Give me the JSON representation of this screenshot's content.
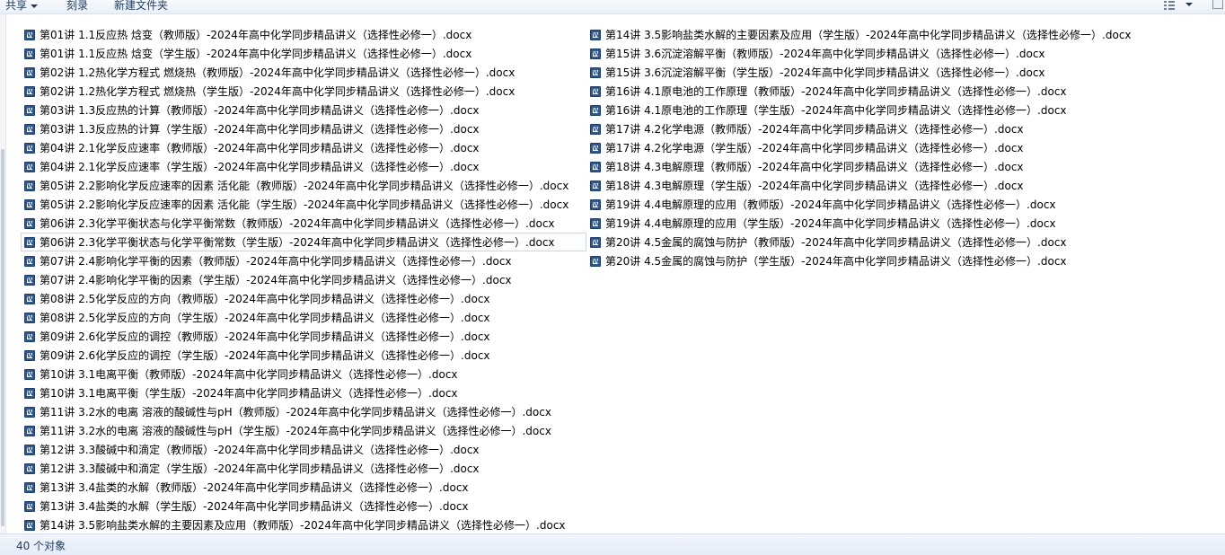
{
  "toolbar": {
    "share_label": "共享",
    "burn_label": "刻录",
    "new_folder_label": "新建文件夹",
    "view_icon": "view-toggle-icon",
    "help_icon": "preview-pane-icon"
  },
  "files_left": [
    {
      "name": "第01讲 1.1反应热  焓变（教师版）-2024年高中化学同步精品讲义（选择性必修一）.docx"
    },
    {
      "name": "第01讲 1.1反应热  焓变（学生版）-2024年高中化学同步精品讲义（选择性必修一）.docx"
    },
    {
      "name": "第02讲 1.2热化学方程式  燃烧热（教师版）-2024年高中化学同步精品讲义（选择性必修一）.docx"
    },
    {
      "name": "第02讲 1.2热化学方程式  燃烧热（学生版）-2024年高中化学同步精品讲义（选择性必修一）.docx"
    },
    {
      "name": "第03讲 1.3反应热的计算（教师版）-2024年高中化学同步精品讲义（选择性必修一）.docx"
    },
    {
      "name": "第03讲 1.3反应热的计算（学生版）-2024年高中化学同步精品讲义（选择性必修一）.docx"
    },
    {
      "name": "第04讲 2.1化学反应速率（教师版）-2024年高中化学同步精品讲义（选择性必修一）.docx"
    },
    {
      "name": "第04讲 2.1化学反应速率（学生版）-2024年高中化学同步精品讲义（选择性必修一）.docx"
    },
    {
      "name": "第05讲 2.2影响化学反应速率的因素  活化能（教师版）-2024年高中化学同步精品讲义（选择性必修一）.docx"
    },
    {
      "name": "第05讲 2.2影响化学反应速率的因素  活化能（学生版）-2024年高中化学同步精品讲义（选择性必修一）.docx"
    },
    {
      "name": "第06讲 2.3化学平衡状态与化学平衡常数（教师版）-2024年高中化学同步精品讲义（选择性必修一）.docx"
    },
    {
      "name": "第06讲 2.3化学平衡状态与化学平衡常数（学生版）-2024年高中化学同步精品讲义（选择性必修一）.docx"
    },
    {
      "name": "第07讲 2.4影响化学平衡的因素（教师版）-2024年高中化学同步精品讲义（选择性必修一）.docx"
    },
    {
      "name": "第07讲 2.4影响化学平衡的因素（学生版）-2024年高中化学同步精品讲义（选择性必修一）.docx"
    },
    {
      "name": "第08讲 2.5化学反应的方向（教师版）-2024年高中化学同步精品讲义（选择性必修一）.docx"
    },
    {
      "name": "第08讲 2.5化学反应的方向（学生版）-2024年高中化学同步精品讲义（选择性必修一）.docx"
    },
    {
      "name": "第09讲 2.6化学反应的调控（教师版）-2024年高中化学同步精品讲义（选择性必修一）.docx"
    },
    {
      "name": "第09讲 2.6化学反应的调控（学生版）-2024年高中化学同步精品讲义（选择性必修一）.docx"
    },
    {
      "name": "第10讲 3.1电离平衡（教师版）-2024年高中化学同步精品讲义（选择性必修一）.docx"
    },
    {
      "name": "第10讲 3.1电离平衡（学生版）-2024年高中化学同步精品讲义（选择性必修一）.docx"
    },
    {
      "name": "第11讲 3.2水的电离  溶液的酸碱性与pH（教师版）-2024年高中化学同步精品讲义（选择性必修一）.docx"
    },
    {
      "name": "第11讲 3.2水的电离  溶液的酸碱性与pH（学生版）-2024年高中化学同步精品讲义（选择性必修一）.docx"
    },
    {
      "name": "第12讲 3.3酸碱中和滴定（教师版）-2024年高中化学同步精品讲义（选择性必修一）.docx"
    },
    {
      "name": "第12讲 3.3酸碱中和滴定（学生版）-2024年高中化学同步精品讲义（选择性必修一）.docx"
    },
    {
      "name": "第13讲 3.4盐类的水解（教师版）-2024年高中化学同步精品讲义（选择性必修一）.docx"
    },
    {
      "name": "第13讲 3.4盐类的水解（学生版）-2024年高中化学同步精品讲义（选择性必修一）.docx"
    },
    {
      "name": "第14讲 3.5影响盐类水解的主要因素及应用（教师版）-2024年高中化学同步精品讲义（选择性必修一）.docx"
    }
  ],
  "files_right": [
    {
      "name": "第14讲 3.5影响盐类水解的主要因素及应用（学生版）-2024年高中化学同步精品讲义（选择性必修一）.docx"
    },
    {
      "name": "第15讲 3.6沉淀溶解平衡（教师版）-2024年高中化学同步精品讲义（选择性必修一）.docx"
    },
    {
      "name": "第15讲 3.6沉淀溶解平衡（学生版）-2024年高中化学同步精品讲义（选择性必修一）.docx"
    },
    {
      "name": "第16讲 4.1原电池的工作原理（教师版）-2024年高中化学同步精品讲义（选择性必修一）.docx"
    },
    {
      "name": "第16讲 4.1原电池的工作原理（学生版）-2024年高中化学同步精品讲义（选择性必修一）.docx"
    },
    {
      "name": "第17讲 4.2化学电源（教师版）-2024年高中化学同步精品讲义（选择性必修一）.docx"
    },
    {
      "name": "第17讲 4.2化学电源（学生版）-2024年高中化学同步精品讲义（选择性必修一）.docx"
    },
    {
      "name": "第18讲 4.3电解原理（教师版）-2024年高中化学同步精品讲义（选择性必修一）.docx"
    },
    {
      "name": "第18讲 4.3电解原理（学生版）-2024年高中化学同步精品讲义（选择性必修一）.docx"
    },
    {
      "name": "第19讲 4.4电解原理的应用（教师版）-2024年高中化学同步精品讲义（选择性必修一）.docx"
    },
    {
      "name": "第19讲 4.4电解原理的应用（学生版）-2024年高中化学同步精品讲义（选择性必修一）.docx"
    },
    {
      "name": "第20讲 4.5金属的腐蚀与防护（教师版）-2024年高中化学同步精品讲义（选择性必修一）.docx"
    },
    {
      "name": "第20讲 4.5金属的腐蚀与防护（学生版）-2024年高中化学同步精品讲义（选择性必修一）.docx"
    }
  ],
  "selected_item": "第06讲 2.3化学平衡状态与化学平衡常数（学生版）-2024年高中化学同步精品讲义（选择性必修一）.docx",
  "file_icon": "word-document-icon",
  "status": {
    "count_text": "40 个对象"
  },
  "colors": {
    "toolbar_text": "#1e395b",
    "word_icon": "#2b5797",
    "selection_border": "#c9d7e8"
  }
}
